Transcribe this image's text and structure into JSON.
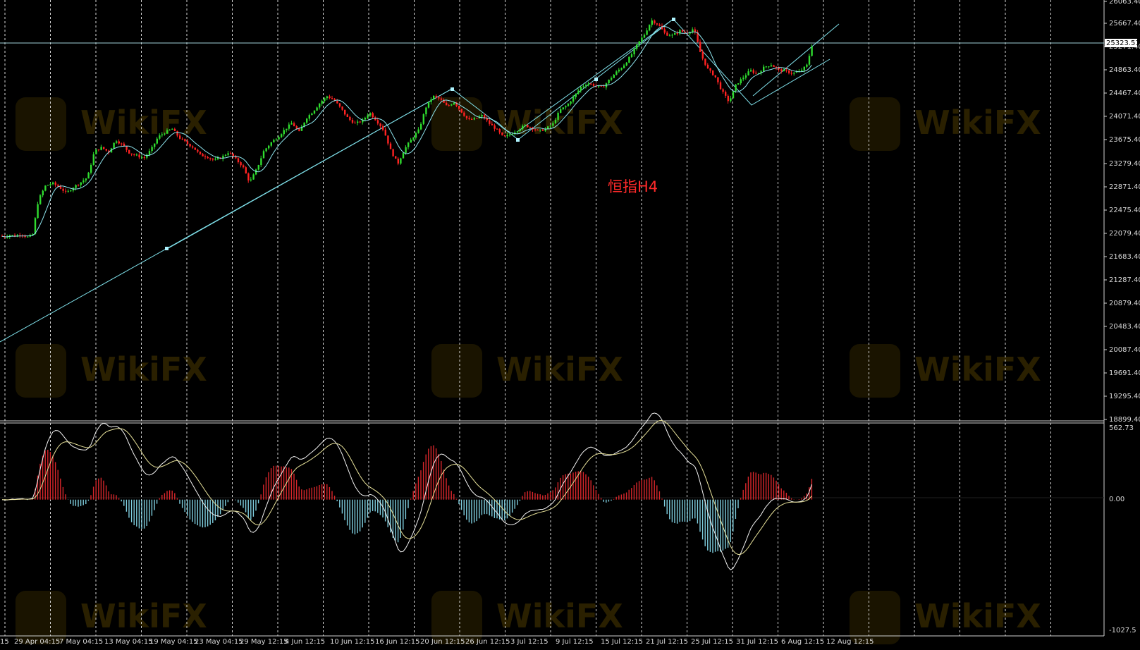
{
  "chart_data": [
    {
      "type": "candlestick",
      "annotation": "恒指H4",
      "y_axis_labels": [
        "26063.40",
        "25667.40",
        "25271.40",
        "24863.40",
        "24467.40",
        "24071.40",
        "23675.40",
        "23279.40",
        "22871.40",
        "22475.40",
        "22079.40",
        "21683.40",
        "21287.40",
        "20879.40",
        "20483.40",
        "20087.40",
        "19691.40",
        "19295.40",
        "18899.40"
      ],
      "ylim": [
        18899.4,
        26063.4
      ],
      "current_price": "25323.51",
      "x_axis_labels": [
        "15",
        "29 Apr 04:15",
        "7 May 04:15",
        "13 May 04:15",
        "19 May 04:15",
        "23 May 04:15",
        "29 May 12:15",
        "4 Jun 12:15",
        "10 Jun 12:15",
        "16 Jun 12:15",
        "20 Jun 12:15",
        "26 Jun 12:15",
        "3 Jul 12:15",
        "9 Jul 12:15",
        "15 Jul 12:15",
        "21 Jul 12:15",
        "25 Jul 12:15",
        "31 Jul 12:15",
        "6 Aug 12:15",
        "12 Aug 12:15"
      ],
      "price_path": [
        [
          0,
          22050
        ],
        [
          8,
          22030
        ],
        [
          16,
          22060
        ],
        [
          24,
          22040
        ],
        [
          32,
          22080
        ],
        [
          40,
          22020
        ],
        [
          48,
          22060
        ],
        [
          56,
          22650
        ],
        [
          66,
          22900
        ],
        [
          76,
          22950
        ],
        [
          86,
          22880
        ],
        [
          96,
          22780
        ],
        [
          106,
          22880
        ],
        [
          116,
          22960
        ],
        [
          126,
          23050
        ],
        [
          136,
          23500
        ],
        [
          146,
          23560
        ],
        [
          156,
          23480
        ],
        [
          166,
          23690
        ],
        [
          176,
          23600
        ],
        [
          186,
          23460
        ],
        [
          196,
          23420
        ],
        [
          206,
          23380
        ],
        [
          216,
          23520
        ],
        [
          226,
          23740
        ],
        [
          236,
          23820
        ],
        [
          246,
          23880
        ],
        [
          256,
          23730
        ],
        [
          266,
          23640
        ],
        [
          276,
          23560
        ],
        [
          286,
          23430
        ],
        [
          296,
          23400
        ],
        [
          306,
          23340
        ],
        [
          316,
          23390
        ],
        [
          326,
          23480
        ],
        [
          336,
          23360
        ],
        [
          346,
          23240
        ],
        [
          356,
          22960
        ],
        [
          366,
          23190
        ],
        [
          376,
          23500
        ],
        [
          386,
          23640
        ],
        [
          396,
          23740
        ],
        [
          406,
          23870
        ],
        [
          416,
          23980
        ],
        [
          426,
          23820
        ],
        [
          436,
          24060
        ],
        [
          446,
          24180
        ],
        [
          456,
          24330
        ],
        [
          466,
          24440
        ],
        [
          476,
          24370
        ],
        [
          486,
          24220
        ],
        [
          496,
          24050
        ],
        [
          506,
          23970
        ],
        [
          516,
          24020
        ],
        [
          526,
          24160
        ],
        [
          536,
          24020
        ],
        [
          546,
          23860
        ],
        [
          556,
          23510
        ],
        [
          566,
          23280
        ],
        [
          576,
          23540
        ],
        [
          586,
          23710
        ],
        [
          596,
          23860
        ],
        [
          606,
          24250
        ],
        [
          616,
          24440
        ],
        [
          626,
          24390
        ],
        [
          636,
          24260
        ],
        [
          646,
          24340
        ],
        [
          656,
          24180
        ],
        [
          666,
          24030
        ],
        [
          676,
          24050
        ],
        [
          686,
          24110
        ],
        [
          696,
          23970
        ],
        [
          706,
          23870
        ],
        [
          716,
          23730
        ],
        [
          726,
          23790
        ],
        [
          736,
          23860
        ],
        [
          746,
          23940
        ],
        [
          756,
          23900
        ],
        [
          766,
          23840
        ],
        [
          776,
          23880
        ],
        [
          786,
          23960
        ],
        [
          796,
          24200
        ],
        [
          806,
          24280
        ],
        [
          816,
          24430
        ],
        [
          826,
          24600
        ],
        [
          836,
          24660
        ],
        [
          846,
          24620
        ],
        [
          856,
          24580
        ],
        [
          866,
          24720
        ],
        [
          876,
          24850
        ],
        [
          886,
          24960
        ],
        [
          896,
          25120
        ],
        [
          906,
          25330
        ],
        [
          916,
          25500
        ],
        [
          926,
          25740
        ],
        [
          936,
          25660
        ],
        [
          946,
          25500
        ],
        [
          956,
          25480
        ],
        [
          966,
          25560
        ],
        [
          976,
          25520
        ],
        [
          986,
          25600
        ],
        [
          996,
          25150
        ],
        [
          1006,
          24900
        ],
        [
          1016,
          24780
        ],
        [
          1026,
          24520
        ],
        [
          1036,
          24340
        ],
        [
          1046,
          24640
        ],
        [
          1056,
          24760
        ],
        [
          1066,
          24880
        ],
        [
          1076,
          24820
        ],
        [
          1086,
          24940
        ],
        [
          1096,
          24980
        ],
        [
          1106,
          24890
        ],
        [
          1116,
          24870
        ],
        [
          1126,
          24830
        ],
        [
          1136,
          24860
        ],
        [
          1146,
          24960
        ],
        [
          1154,
          25330
        ]
      ],
      "indicator": {
        "type": "macd",
        "y_axis_labels": [
          "562.73",
          "0.00",
          "-1027.5"
        ],
        "ylim": [
          -1027.5,
          562.73
        ]
      }
    }
  ]
}
